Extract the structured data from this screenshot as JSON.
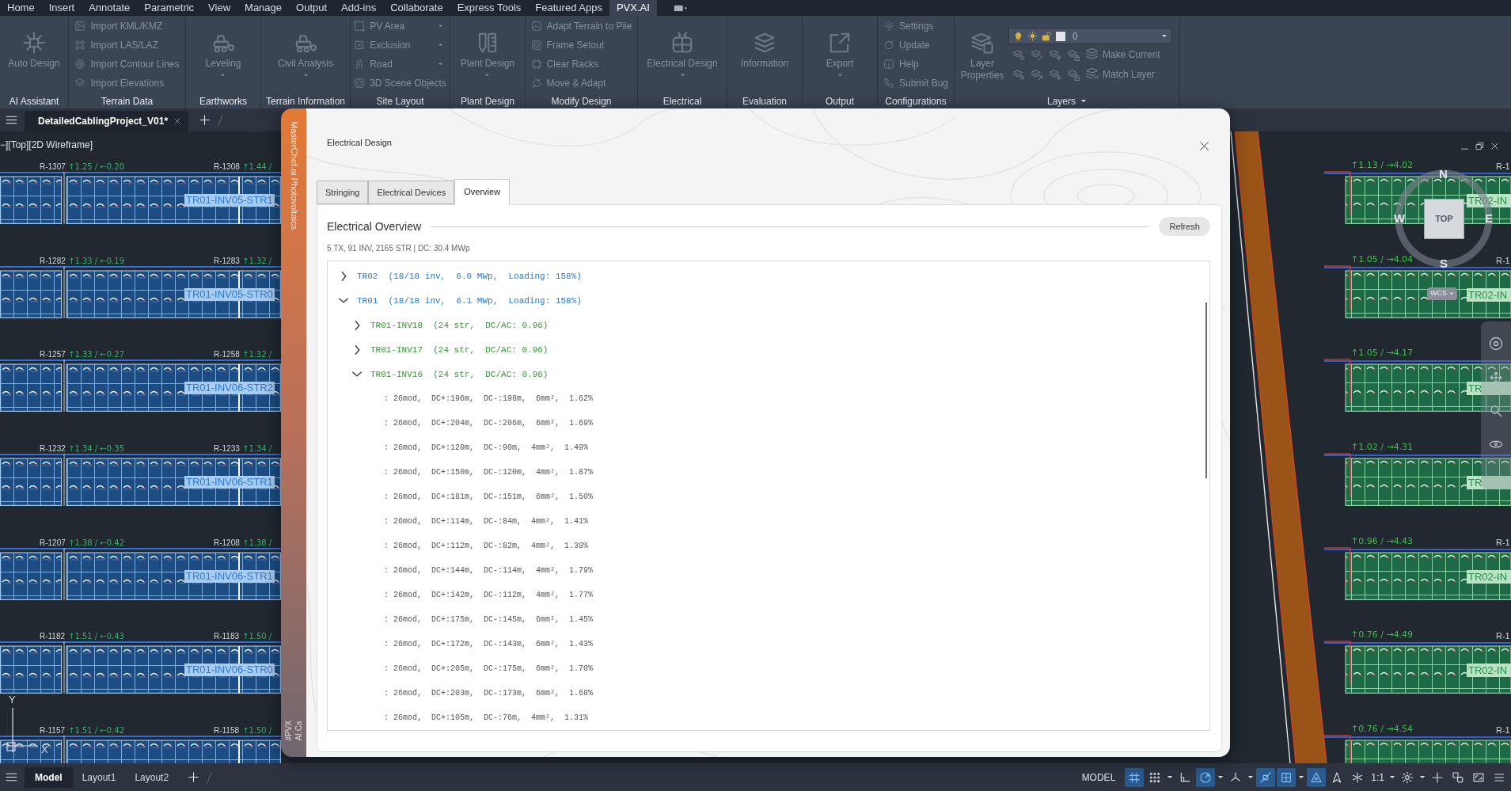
{
  "menu_bar": {
    "tabs": [
      {
        "label": "Home",
        "selected": false
      },
      {
        "label": "Insert",
        "selected": false
      },
      {
        "label": "Annotate",
        "selected": false
      },
      {
        "label": "Parametric",
        "selected": false
      },
      {
        "label": "View",
        "selected": false
      },
      {
        "label": "Manage",
        "selected": false
      },
      {
        "label": "Output",
        "selected": false
      },
      {
        "label": "Add-ins",
        "selected": false
      },
      {
        "label": "Collaborate",
        "selected": false
      },
      {
        "label": "Express Tools",
        "selected": false
      },
      {
        "label": "Featured Apps",
        "selected": false
      },
      {
        "label": "PVX.AI",
        "selected": true
      }
    ]
  },
  "ribbon": {
    "disabled": true,
    "panels": [
      {
        "label": "AI Assistant",
        "dropdown": false,
        "items": [
          {
            "kind": "large",
            "label": "Auto Design",
            "dropdown": false
          }
        ]
      },
      {
        "label": "Terrain Data",
        "dropdown": false,
        "items": [
          {
            "kind": "small",
            "label": "Import KML/KMZ",
            "dropdown": false
          },
          {
            "kind": "small",
            "label": "Import LAS/LAZ",
            "dropdown": false
          },
          {
            "kind": "small",
            "label": "Import Contour Lines",
            "dropdown": false
          },
          {
            "kind": "small",
            "label": "Import Elevations",
            "dropdown": false
          }
        ]
      },
      {
        "label": "Earthworks",
        "dropdown": false,
        "items": [
          {
            "kind": "large",
            "label": "Leveling",
            "dropdown": true
          }
        ]
      },
      {
        "label": "Terrain Information",
        "dropdown": false,
        "items": [
          {
            "kind": "large",
            "label": "Civil Analysis",
            "dropdown": true
          }
        ]
      },
      {
        "label": "Site Layout",
        "dropdown": false,
        "items": [
          {
            "kind": "small",
            "label": "PV Area",
            "dropdown": true
          },
          {
            "kind": "small",
            "label": "Exclusion",
            "dropdown": true
          },
          {
            "kind": "small",
            "label": "Road",
            "dropdown": true
          },
          {
            "kind": "small",
            "label": "3D Scene Objects",
            "dropdown": false
          }
        ]
      },
      {
        "label": "Plant Design",
        "dropdown": false,
        "items": [
          {
            "kind": "large",
            "label": "Plant Design",
            "dropdown": true
          }
        ]
      },
      {
        "label": "Modify Design",
        "dropdown": false,
        "items": [
          {
            "kind": "small",
            "label": "Adapt Terrain to Pile",
            "dropdown": false
          },
          {
            "kind": "small",
            "label": "Frame Setout",
            "dropdown": false
          },
          {
            "kind": "small",
            "label": "Clear Racks",
            "dropdown": false
          },
          {
            "kind": "small",
            "label": "Move & Adapt",
            "dropdown": false
          }
        ]
      },
      {
        "label": "Electrical",
        "dropdown": false,
        "items": [
          {
            "kind": "large",
            "label": "Electrical Design",
            "dropdown": true
          }
        ]
      },
      {
        "label": "Evaluation",
        "dropdown": false,
        "items": [
          {
            "kind": "large",
            "label": "Information",
            "dropdown": false
          }
        ]
      },
      {
        "label": "Output",
        "dropdown": false,
        "items": [
          {
            "kind": "large",
            "label": "Export",
            "dropdown": true
          }
        ]
      },
      {
        "label": "Configurations",
        "dropdown": false,
        "items": [
          {
            "kind": "small",
            "label": "Settings",
            "dropdown": false
          },
          {
            "kind": "small",
            "label": "Update",
            "dropdown": false
          },
          {
            "kind": "small",
            "label": "Help",
            "dropdown": false
          },
          {
            "kind": "small",
            "label": "Submit Bug",
            "dropdown": false
          }
        ]
      },
      {
        "label": "Layers",
        "dropdown": true,
        "items": [
          {
            "kind": "large",
            "label": "Layer Properties",
            "dropdown": false
          },
          {
            "kind": "layer_select",
            "value": "0"
          },
          {
            "kind": "tool_row",
            "label": "Make Current"
          },
          {
            "kind": "tool_row",
            "label": "Match Layer"
          }
        ]
      }
    ]
  },
  "document_tabs": [
    {
      "label": "DetailedCablingProject_V01*",
      "selected": true
    }
  ],
  "viewport": {
    "label": "−][Top][2D Wireframe]",
    "left_rows": [
      {
        "labels": [
          {
            "rack": "R-1307",
            "reading": "↑1.25 / ←0.20"
          },
          {
            "rack": "R-1308",
            "reading": "↑1.44 /"
          }
        ],
        "table_label": "TR01-INV05-STR1"
      },
      {
        "labels": [
          {
            "rack": "R-1282",
            "reading": "↑1.33 / ←0.19"
          },
          {
            "rack": "R-1283",
            "reading": "↑1.32 /"
          }
        ],
        "table_label": "TR01-INV05-STR0"
      },
      {
        "labels": [
          {
            "rack": "R-1257",
            "reading": "↑1.33 / ←0.27"
          },
          {
            "rack": "R-1258",
            "reading": "↑1.32 /"
          }
        ],
        "table_label": "TR01-INV06-STR2"
      },
      {
        "labels": [
          {
            "rack": "R-1232",
            "reading": "↑1.34 / ←0.35"
          },
          {
            "rack": "R-1233",
            "reading": "↑1.34 /"
          }
        ],
        "table_label": "TR01-INV06-STR1"
      },
      {
        "labels": [
          {
            "rack": "R-1207",
            "reading": "↑1.38 / ←0.42"
          },
          {
            "rack": "R-1208",
            "reading": "↑1.38 /"
          }
        ],
        "table_label": "TR01-INV06-STR1"
      },
      {
        "labels": [
          {
            "rack": "R-1182",
            "reading": "↑1.51 / ←0.43"
          },
          {
            "rack": "R-1183",
            "reading": "↑1.50 /"
          }
        ],
        "table_label": "TR01-INV06-STR0"
      },
      {
        "labels": [
          {
            "rack": "R-1157",
            "reading": "↑1.51 / ←0.42"
          },
          {
            "rack": "R-1158",
            "reading": "↑1.50 /"
          }
        ]
      }
    ],
    "right_rows": [
      {
        "reading": "↑1.13 / →4.02",
        "rack": "R-1",
        "table_label": "TR02-IN"
      },
      {
        "reading": "↑1.05 / →4.04",
        "rack": "R-1",
        "table_label": "TR02-IN"
      },
      {
        "reading": "↑1.05 / →4.17",
        "table_label": "TR"
      },
      {
        "reading": "↑1.02 / →4.31",
        "table_label": "TR"
      },
      {
        "reading": "↑0.96 / →4.43",
        "rack": "R-1",
        "table_label": "TR02-IN"
      },
      {
        "reading": "↑0.76 / →4.49",
        "rack": "R-1",
        "table_label": "TR02-IN"
      },
      {
        "reading": "↑0.76 / →4.54",
        "rack": "R-1"
      }
    ],
    "viewcube": {
      "face": "TOP",
      "north": "N",
      "south": "S",
      "east": "E",
      "west": "W",
      "ucs": "WCS"
    },
    "axes": {
      "y": "Y",
      "x": "X"
    }
  },
  "dialog": {
    "brand": "MasterChef.ai Photovoltaics",
    "footer": [
      "#PVX",
      "AI.Ca"
    ],
    "title": "Electrical Design",
    "tabs": [
      {
        "label": "Stringing",
        "selected": false
      },
      {
        "label": "Electrical Devices",
        "selected": false
      },
      {
        "label": "Overview",
        "selected": true
      }
    ],
    "heading": "Electrical Overview",
    "refresh": "Refresh",
    "summary": "5 TX, 91 INV, 2165 STR | DC: 30.4 MWp",
    "tree": [
      {
        "label": "TR02  (18/18 inv,  6.0 MWp,  Loading: 158%)",
        "expanded": false
      },
      {
        "label": "TR01  (18/18 inv,  6.1 MWp,  Loading: 158%)",
        "expanded": true,
        "children": [
          {
            "label": "TR01-INV18  (24 str,  DC/AC: 0.96)",
            "expanded": false
          },
          {
            "label": "TR01-INV17  (24 str,  DC/AC: 0.96)",
            "expanded": false
          },
          {
            "label": "TR01-INV16  (24 str,  DC/AC: 0.96)",
            "expanded": true,
            "children": [
              {
                "label": ": 26mod,  DC+:196m,  DC-:198m,  6mm²,  1.62%"
              },
              {
                "label": ": 26mod,  DC+:204m,  DC-:206m,  6mm²,  1.69%"
              },
              {
                "label": ": 26mod,  DC+:120m,  DC-:90m,  4mm²,  1.49%"
              },
              {
                "label": ": 26mod,  DC+:150m,  DC-:120m,  4mm²,  1.87%"
              },
              {
                "label": ": 26mod,  DC+:181m,  DC-:151m,  6mm²,  1.50%"
              },
              {
                "label": ": 26mod,  DC+:114m,  DC-:84m,  4mm²,  1.41%"
              },
              {
                "label": ": 26mod,  DC+:112m,  DC-:82m,  4mm²,  1.39%"
              },
              {
                "label": ": 26mod,  DC+:144m,  DC-:114m,  4mm²,  1.79%"
              },
              {
                "label": ": 26mod,  DC+:142m,  DC-:112m,  4mm²,  1.77%"
              },
              {
                "label": ": 26mod,  DC+:175m,  DC-:145m,  6mm²,  1.45%"
              },
              {
                "label": ": 26mod,  DC+:172m,  DC-:143m,  6mm²,  1.43%"
              },
              {
                "label": ": 26mod,  DC+:205m,  DC-:175m,  6mm²,  1.70%"
              },
              {
                "label": ": 26mod,  DC+:203m,  DC-:173m,  6mm²,  1.68%"
              },
              {
                "label": ": 26mod,  DC+:105m,  DC-:76m,  4mm²,  1.31%"
              }
            ]
          }
        ]
      }
    ]
  },
  "status_bar": {
    "layout_tabs": [
      {
        "label": "Model",
        "selected": true
      },
      {
        "label": "Layout1",
        "selected": false
      },
      {
        "label": "Layout2",
        "selected": false
      }
    ],
    "space": "MODEL",
    "tools": [
      {
        "kind": "grid",
        "on": true
      },
      {
        "kind": "snap",
        "on": false
      },
      {
        "kind": "caret"
      },
      {
        "kind": "ortho",
        "on": false
      },
      {
        "kind": "polar",
        "on": true
      },
      {
        "kind": "caret"
      },
      {
        "kind": "isodraft",
        "on": false
      },
      {
        "kind": "caret"
      },
      {
        "kind": "osnap",
        "on": true
      },
      {
        "kind": "otrack",
        "on": true
      },
      {
        "kind": "caret"
      },
      {
        "kind": "annotation",
        "on": true
      },
      {
        "kind": "visibility",
        "on": false
      },
      {
        "kind": "autoscale",
        "on": false
      },
      {
        "kind": "scale",
        "label": "1:1"
      },
      {
        "kind": "caret"
      },
      {
        "kind": "gear"
      },
      {
        "kind": "caret"
      },
      {
        "kind": "plus"
      },
      {
        "kind": "isolate"
      },
      {
        "kind": "fullscreen"
      },
      {
        "kind": "menu"
      }
    ]
  }
}
